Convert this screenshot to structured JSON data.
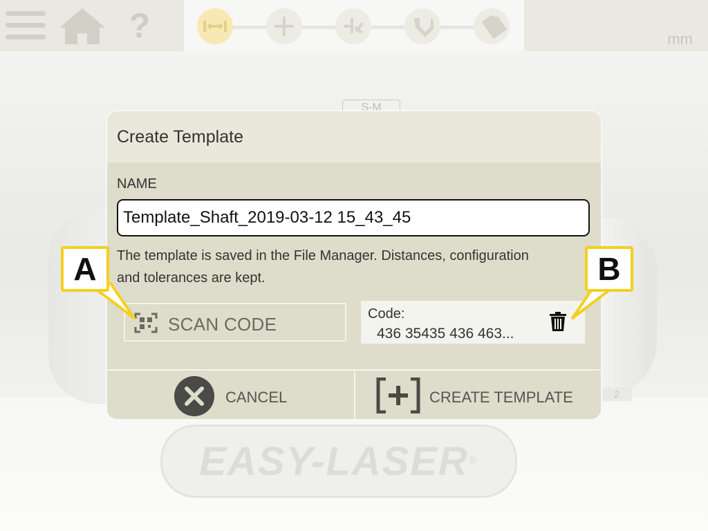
{
  "topbar": {
    "unit": "mm",
    "steps": [
      {
        "name": "distance-step",
        "active": true
      },
      {
        "name": "measure-step",
        "active": false
      },
      {
        "name": "align-step",
        "active": false
      },
      {
        "name": "adjust-step",
        "active": false
      },
      {
        "name": "save-step",
        "active": false
      }
    ]
  },
  "background": {
    "logo_text": "EASY-LASER",
    "tag_text": "S-M",
    "tag2_text": "2"
  },
  "dialog": {
    "title": "Create Template",
    "name_label": "NAME",
    "name_value": "Template_Shaft_2019-03-12 15_43_45",
    "info_line1": "The template is saved in the File Manager. Distances, configuration",
    "info_line2": "and tolerances are kept.",
    "scan_label": "SCAN CODE",
    "code_label": "Code:",
    "code_value": "436 35435 436 463...",
    "cancel_label": "CANCEL",
    "create_label": "CREATE TEMPLATE"
  },
  "callouts": {
    "a": "A",
    "b": "B"
  },
  "colors": {
    "dialog_bg": "#dedcca",
    "header_bg": "#e9e8da",
    "callout_border": "#f5cf1f",
    "active_step": "#f8e9b4"
  }
}
